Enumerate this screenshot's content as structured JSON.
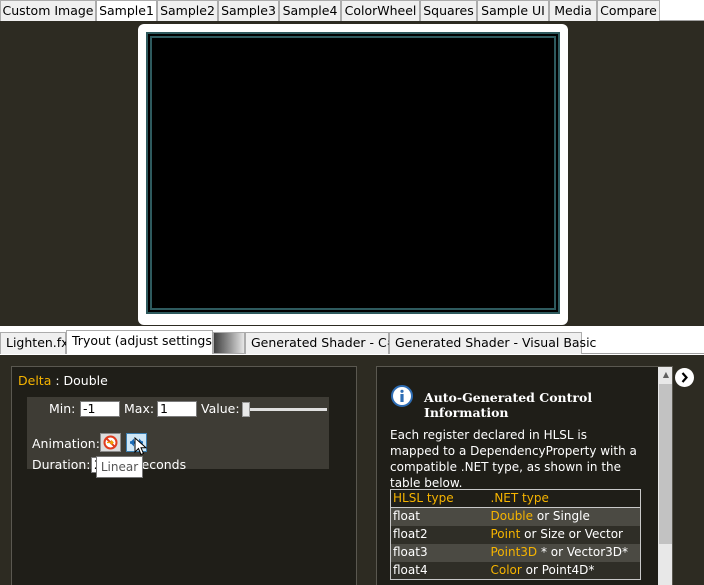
{
  "top_tabs": [
    {
      "label": "Custom Image"
    },
    {
      "label": "Sample1",
      "selected": true
    },
    {
      "label": "Sample2"
    },
    {
      "label": "Sample3"
    },
    {
      "label": "Sample4"
    },
    {
      "label": "ColorWheel"
    },
    {
      "label": "Squares"
    },
    {
      "label": "Sample UI"
    },
    {
      "label": "Media"
    },
    {
      "label": "Compare"
    }
  ],
  "bottom_tabs": [
    {
      "label": "Lighten.fx"
    },
    {
      "label": "Tryout (adjust settings)",
      "selected": true
    },
    {
      "label": "Generated Shader - C#"
    },
    {
      "label": "Generated Shader - Visual Basic"
    }
  ],
  "property": {
    "name": "Delta",
    "separator": " : ",
    "type": "Double"
  },
  "settings": {
    "min_label": "Min:",
    "min_value": "-1",
    "max_label": "Max:",
    "max_value": "1",
    "value_label": "Value:",
    "slider_fraction": 0.0,
    "animation_label": "Animation:",
    "duration_label": "Duration:",
    "duration_value": "2",
    "duration_unit": "seconds",
    "tooltip": "Linear"
  },
  "info": {
    "title": "Auto-Generated Control Information",
    "description": "Each register declared in HLSL is mapped to a DependencyProperty with a compatible .NET type, as shown in the table below.",
    "table": {
      "headers": [
        "HLSL type",
        ".NET type"
      ],
      "rows": [
        {
          "hlsl": "float",
          "net": "Double",
          "alt": " or Single"
        },
        {
          "hlsl": "float2",
          "net": "Point",
          "alt": " or Size or Vector"
        },
        {
          "hlsl": "float3",
          "net": "Point3D",
          "alt": " * or Vector3D*"
        },
        {
          "hlsl": "float4",
          "net": "Color",
          "alt": " or Point4D*"
        }
      ]
    }
  },
  "colors": {
    "panel_background": "#2d2b22",
    "accent_yellow": "#f6b400",
    "frame_border": "#2e5a5e"
  },
  "icons": {
    "stop": "no-animation-icon",
    "linear": "linear-animation-icon",
    "info": "info-icon",
    "expand": "chevron-right-icon"
  }
}
